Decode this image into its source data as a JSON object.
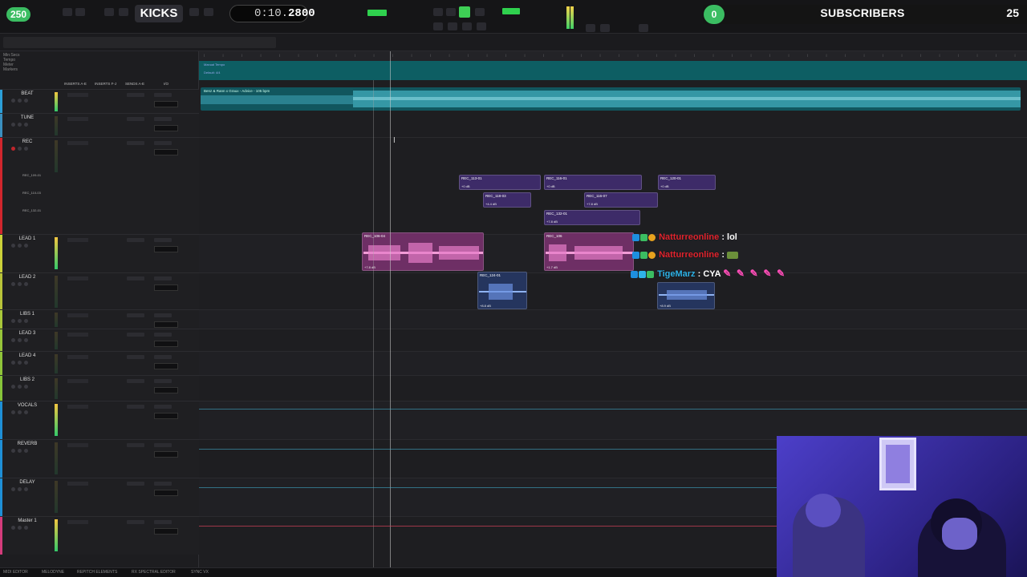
{
  "stream_overlay": {
    "left_badge": "250",
    "kicks_label": "KICKS",
    "counter_prefix": "0:10.",
    "counter_value": "2800",
    "subscribers_left_count": "0",
    "subscribers_label": "SUBSCRIBERS",
    "subscribers_right_count": "25"
  },
  "tracks": [
    {
      "name": "BEAT",
      "color": "#2b9fd8"
    },
    {
      "name": "TUNE",
      "color": "#3a8fbf"
    },
    {
      "name": "REC",
      "color": "#d1262d",
      "subs": [
        "REC_109-01",
        "REC_110-03",
        "REC_132-01"
      ]
    },
    {
      "name": "LEAD 1",
      "color": "#cbd13a"
    },
    {
      "name": "LEAD 2",
      "color": "#b8c33a"
    },
    {
      "name": "LIBS 1",
      "color": "#a8c73a"
    },
    {
      "name": "LEAD 3",
      "color": "#97c43a"
    },
    {
      "name": "LEAD 4",
      "color": "#8fc43a"
    },
    {
      "name": "LIBS 2",
      "color": "#86c43a"
    },
    {
      "name": "VOCALS",
      "color": "#1e8fd6"
    },
    {
      "name": "REVERB",
      "color": "#1e8fd6"
    },
    {
      "name": "DELAY",
      "color": "#1e8fd6"
    },
    {
      "name": "Master 1",
      "color": "#d43b7b"
    }
  ],
  "column_headers": [
    "INSERTS A-E",
    "INSERTS F-J",
    "SENDS A-E",
    "I/O"
  ],
  "timeline": {
    "beat_clip": "Benz & Rann x Graux - Advice - 105 bpm",
    "ruler_rows": [
      "Manual Tempo",
      "Default: 4/4"
    ],
    "clips": [
      {
        "name": "REC_113-01",
        "gain": "+0 dB"
      },
      {
        "name": "REC_116-01",
        "gain": "+0 dB"
      },
      {
        "name": "REC_120-01",
        "gain": "+0 dB"
      },
      {
        "name": "REC_118-03",
        "gain": "+4.4 dB"
      },
      {
        "name": "REC_116-07",
        "gain": "+7.8 dB"
      },
      {
        "name": "REC_132-01",
        "gain": "+7.8 dB"
      },
      {
        "name": "REC_106-04",
        "gain": "+7.8 dB"
      },
      {
        "name": "REC_106",
        "gain": "+7.8 dB"
      },
      {
        "name": "REC_120-01",
        "gain": "+1.7 dB"
      },
      {
        "name": "REC_124-01",
        "gain": "+8.8 dB"
      },
      {
        "name": "",
        "gain": "+8.9 dB"
      }
    ]
  },
  "chat": [
    {
      "user": "Natturreonline",
      "msg": ": lol"
    },
    {
      "user": "Natturreonline",
      "msg": ":"
    },
    {
      "user": "TigeMarz",
      "msg": ": CYA"
    }
  ],
  "bottom_tabs": [
    "MIDI EDITOR",
    "MELODYNE",
    "REPITCH ELEMENTS",
    "RX SPECTRAL EDITOR",
    "SYNC VX"
  ],
  "colors": {
    "accent_green": "#3bbd62",
    "beat_clip": "#11565e",
    "rec_clip": "#3d2b68",
    "lead_clip": "#6e2f65",
    "chat_user": "#e1252f"
  }
}
